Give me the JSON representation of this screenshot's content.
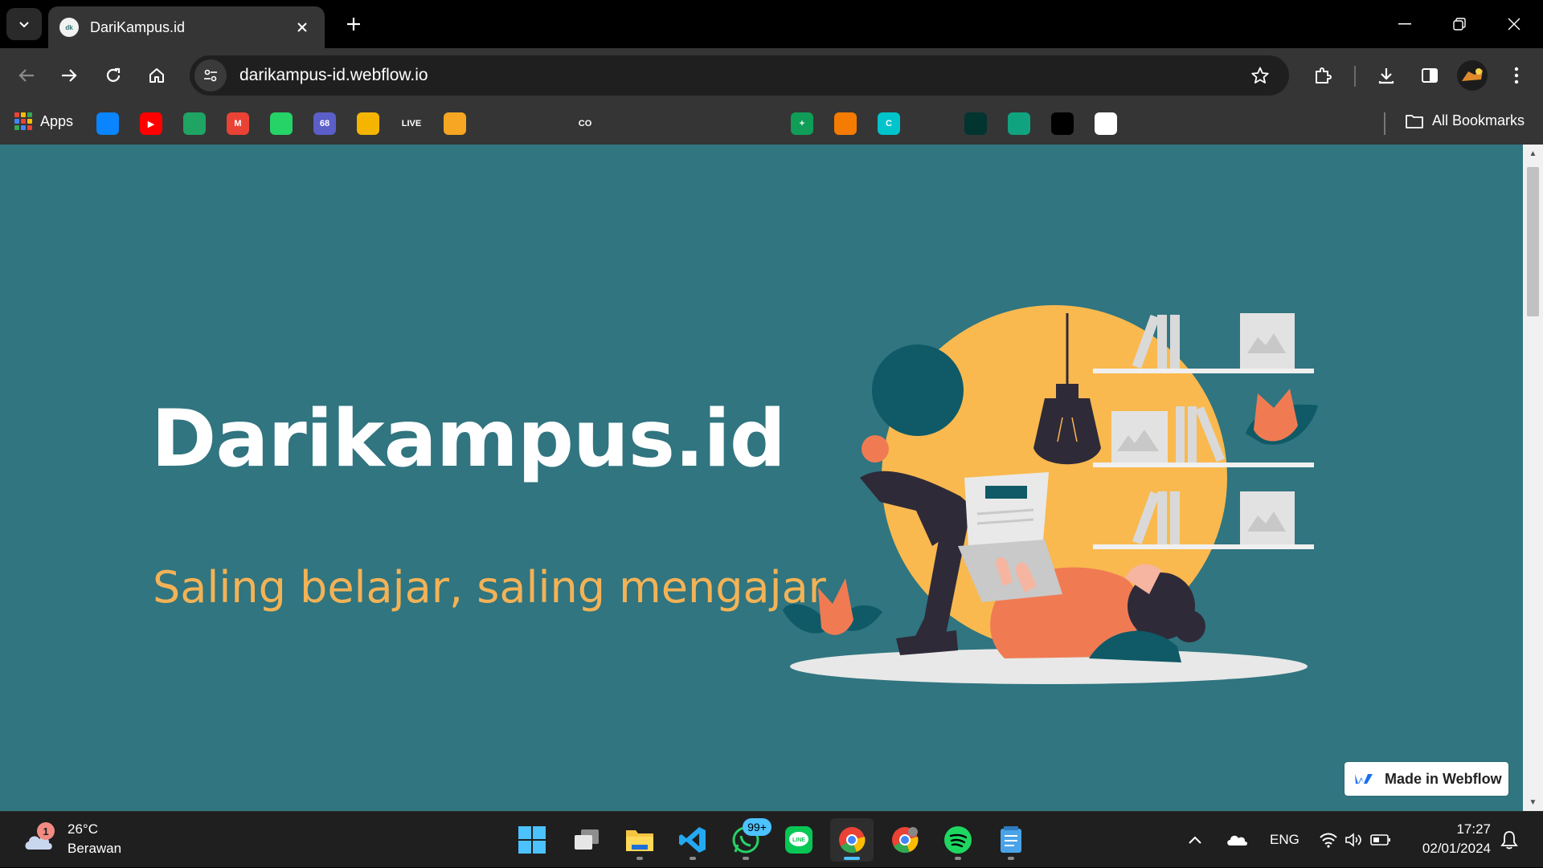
{
  "browser": {
    "tab": {
      "title": "DariKampus.id",
      "favicon_text": "dk"
    },
    "omnibox": {
      "url": "darikampus-id.webflow.io"
    },
    "bookmarks": {
      "apps_label": "Apps",
      "all_bookmarks_label": "All Bookmarks",
      "items": [
        {
          "name": "onedrive-bookmark",
          "color": "#0a84ff",
          "text": ""
        },
        {
          "name": "youtube-bookmark",
          "color": "#ff0000",
          "text": "▶"
        },
        {
          "name": "google-drive-bookmark",
          "color": "#1fa463",
          "text": ""
        },
        {
          "name": "gmail-bookmark",
          "color": "#ea4335",
          "text": "M"
        },
        {
          "name": "whatsapp-bookmark",
          "color": "#25d366",
          "text": ""
        },
        {
          "name": "notification-bookmark",
          "color": "#5b5fc7",
          "text": "68"
        },
        {
          "name": "google-classroom-bookmark",
          "color": "#f4b400",
          "text": ""
        },
        {
          "name": "live-bookmark",
          "color": "#353535",
          "text": "LIVE"
        },
        {
          "name": "crown-bookmark",
          "color": "#f6a623",
          "text": ""
        },
        {
          "name": "globe-bookmark",
          "color": "#353535",
          "text": ""
        },
        {
          "name": "github-bookmark",
          "color": "#353535",
          "text": ""
        },
        {
          "name": "coursera-bookmark",
          "color": "#353535",
          "text": "CO"
        },
        {
          "name": "stackoverflow-bookmark",
          "color": "#353535",
          "text": ""
        },
        {
          "name": "dash-bookmark",
          "color": "#353535",
          "text": ""
        },
        {
          "name": "figma-bookmark",
          "color": "#353535",
          "text": ""
        },
        {
          "name": "google-drive-2-bookmark",
          "color": "#353535",
          "text": ""
        },
        {
          "name": "google-sheets-plus-bookmark",
          "color": "#0f9d58",
          "text": "+"
        },
        {
          "name": "diagram-bookmark",
          "color": "#f57c00",
          "text": ""
        },
        {
          "name": "canva-bookmark",
          "color": "#00c4cc",
          "text": "C"
        },
        {
          "name": "figure-bookmark",
          "color": "#353535",
          "text": ""
        },
        {
          "name": "mongodb-bookmark",
          "color": "#023430",
          "text": ""
        },
        {
          "name": "chatgpt-bookmark",
          "color": "#10a37f",
          "text": ""
        },
        {
          "name": "capcut-bookmark",
          "color": "#000000",
          "text": ""
        },
        {
          "name": "trello-bookmark",
          "color": "#ffffff",
          "text": ""
        },
        {
          "name": "dots-bookmark",
          "color": "#353535",
          "text": ""
        }
      ]
    }
  },
  "page": {
    "hero_title": "Darikampus.id",
    "hero_subtitle": "Saling belajar, saling mengajar",
    "badge": "Made in Webflow",
    "colors": {
      "background": "#307580",
      "subtitle": "#f3b256"
    }
  },
  "taskbar": {
    "weather": {
      "temp": "26°C",
      "condition": "Berawan",
      "badge": "1"
    },
    "whatsapp_badge": "99+",
    "tray": {
      "language": "ENG"
    },
    "clock": {
      "time": "17:27",
      "date": "02/01/2024"
    }
  }
}
